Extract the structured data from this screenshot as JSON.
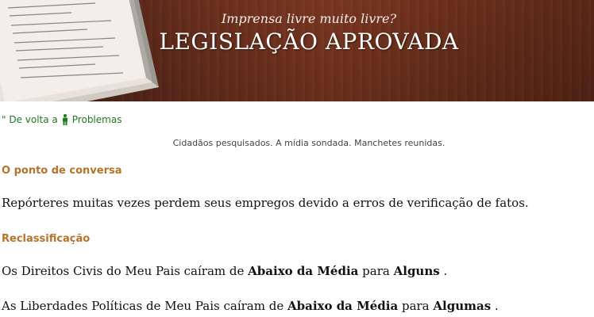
{
  "banner": {
    "tagline": "Imprensa livre muito livre?",
    "headline": "LEGISLAÇÃO APROVADA"
  },
  "nav": {
    "back_prefix": "\" De volta a",
    "back_target": "Problemas"
  },
  "subtitle": "Cidadãos pesquisados. A mídia sondada. Manchetes reunidas.",
  "talking_point": {
    "heading": "O ponto de conversa",
    "text": "Repórteres muitas vezes perdem seus empregos devido a erros de verificação de fatos."
  },
  "reclassification": {
    "heading": "Reclassificação",
    "lines": [
      {
        "pre": "Os Direitos Civis do Meu Pais caíram de",
        "from": "Abaixo da Média",
        "mid": "para",
        "to": "Alguns",
        "end": "."
      },
      {
        "pre": "As Liberdades Políticas de Meu Pais caíram de",
        "from": "Abaixo da Média",
        "mid": "para",
        "to": "Algumas",
        "end": "."
      }
    ]
  },
  "colors": {
    "link": "#1f7a1f",
    "section_heading": "#b8732a",
    "banner_wood": "#6b2f1d"
  }
}
